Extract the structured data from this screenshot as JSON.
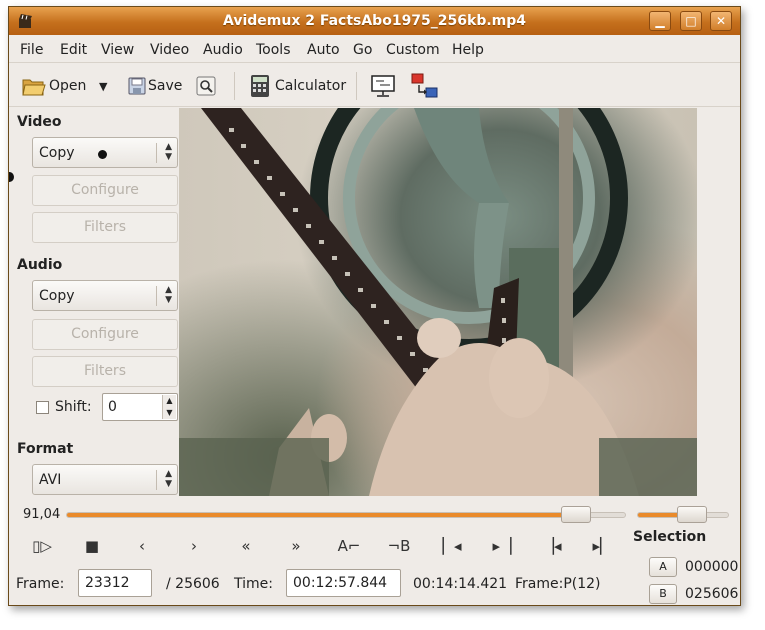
{
  "window": {
    "title": "Avidemux 2 FactsAbo1975_256kb.mp4"
  },
  "menu": [
    "File",
    "Edit",
    "View",
    "Video",
    "Audio",
    "Tools",
    "Auto",
    "Go",
    "Custom",
    "Help"
  ],
  "toolbar": {
    "open_label": "Open",
    "save_label": "Save",
    "calculator_label": "Calculator"
  },
  "video": {
    "label": "Video",
    "codec": "Copy",
    "configure_label": "Configure",
    "filters_label": "Filters"
  },
  "audio": {
    "label": "Audio",
    "codec": "Copy",
    "configure_label": "Configure",
    "filters_label": "Filters",
    "shift_label": "Shift:",
    "shift_value": "0"
  },
  "format": {
    "label": "Format",
    "value": "AVI"
  },
  "slider": {
    "position_label": "91,04",
    "position_percent": 91.04
  },
  "volume": {
    "level_percent": 60
  },
  "status": {
    "frame_label": "Frame:",
    "frame_value": "23312",
    "total_frames": "/ 25606",
    "time_label": "Time:",
    "time_value": "00:12:57.844",
    "duration": "00:14:14.421",
    "frame_type": "Frame:P(12)"
  },
  "selection": {
    "title": "Selection",
    "a_label": "A",
    "a_value": "000000",
    "b_label": "B",
    "b_value": "025606"
  },
  "controls": {
    "mark_a_label": "A",
    "mark_b_label": "B"
  }
}
